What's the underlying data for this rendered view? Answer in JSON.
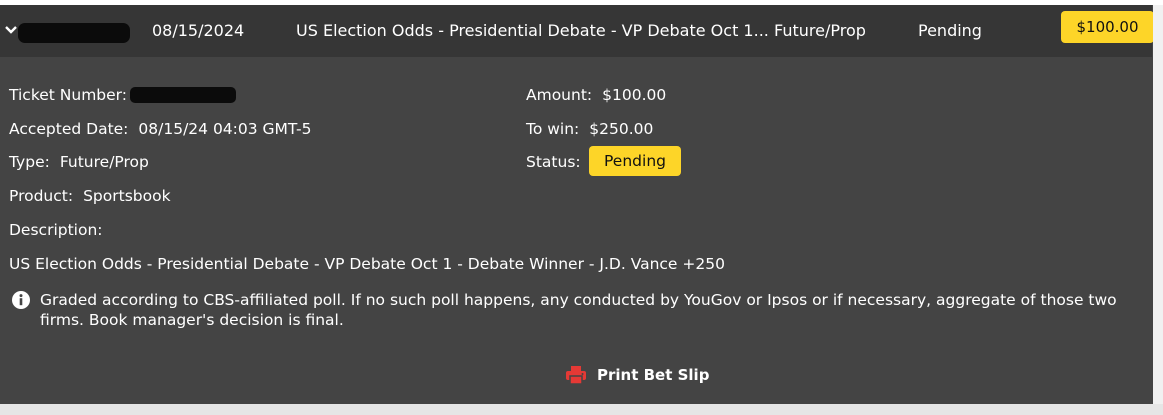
{
  "header": {
    "date": "08/15/2024",
    "event": "US Election Odds - Presidential Debate - VP Debate Oct 1...",
    "bet_type": "Future/Prop",
    "status": "Pending",
    "amount": "$100.00"
  },
  "details": {
    "ticket_label": "Ticket Number:",
    "accepted_label": "Accepted Date:",
    "accepted_value": "08/15/24 04:03 GMT-5",
    "type_label": "Type:",
    "type_value": "Future/Prop",
    "product_label": "Product:",
    "product_value": "Sportsbook",
    "description_label": "Description:",
    "description_value": "US Election Odds - Presidential Debate - VP Debate Oct 1 - Debate Winner - J.D. Vance +250",
    "amount_label": "Amount:",
    "amount_value": "$100.00",
    "towin_label": "To win:",
    "towin_value": "$250.00",
    "status_label": "Status:",
    "status_value": "Pending"
  },
  "note": "Graded according to CBS-affiliated poll. If no such poll happens, any conducted by YouGov or Ipsos or if necessary, aggregate of those two firms. Book manager's decision is final.",
  "actions": {
    "print_label": "Print Bet Slip"
  },
  "icons": {
    "chevron": "chevron-down-icon",
    "info": "info-icon",
    "print": "printer-icon"
  },
  "colors": {
    "accent": "#fdd528",
    "print_icon": "#e53935",
    "panel": "#444444",
    "header": "#363636"
  }
}
